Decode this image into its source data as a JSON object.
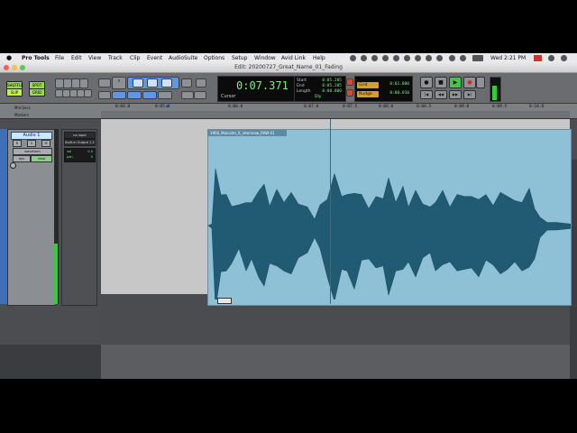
{
  "menubar": {
    "app": "Pro Tools",
    "items": [
      "File",
      "Edit",
      "View",
      "Track",
      "Clip",
      "Event",
      "AudioSuite",
      "Options",
      "Setup",
      "Window",
      "Avid Link",
      "Help"
    ],
    "clock": "Wed 2:21 PM"
  },
  "window": {
    "title": "Edit: 20200727_Great_Name_01_Fading"
  },
  "toolbar": {
    "modes": [
      "SHUFFLE",
      "SPOT",
      "SLIP",
      "GRID"
    ],
    "counter_main": "0:07.371",
    "counter_label": "Cursor",
    "selection": {
      "start_label": "Start",
      "start_value": "0:05.205",
      "end_label": "End",
      "end_value": "0:05.205",
      "length_label": "Length",
      "length_value": "0:00.000"
    },
    "dly": "Dly",
    "grid_label": "Grid",
    "grid_value": "0:01.000",
    "nudge_label": "Nudge",
    "nudge_value": "0:00.010"
  },
  "ruler": {
    "label_min_secs": "Min:Secs",
    "label_markers": "Markers",
    "ticks": [
      "0:04.0",
      "0:05.0",
      "0:06.0",
      "0:07.0",
      "0:07.5",
      "0:08.0",
      "0:08.5",
      "0:09.0",
      "0:09.5",
      "0:10.0"
    ]
  },
  "track": {
    "name": "Audio 1",
    "buttons": [
      "R",
      "S",
      "M"
    ],
    "view": "waveform",
    "dyn": "dyn",
    "read": "read",
    "input": "no input",
    "output": "Built-in Output 1-2",
    "vol_label": "vol",
    "vol_value": "0.0",
    "pan_label": "pan",
    "pan_value": "0"
  },
  "clip": {
    "name": "1960_Malcolm_X_interview_RAW-01"
  },
  "colors": {
    "clip_fill": "#8ec0d6",
    "waveform": "#215a73",
    "counter_text": "#7bf07b",
    "meter": "#2fcf3a"
  }
}
